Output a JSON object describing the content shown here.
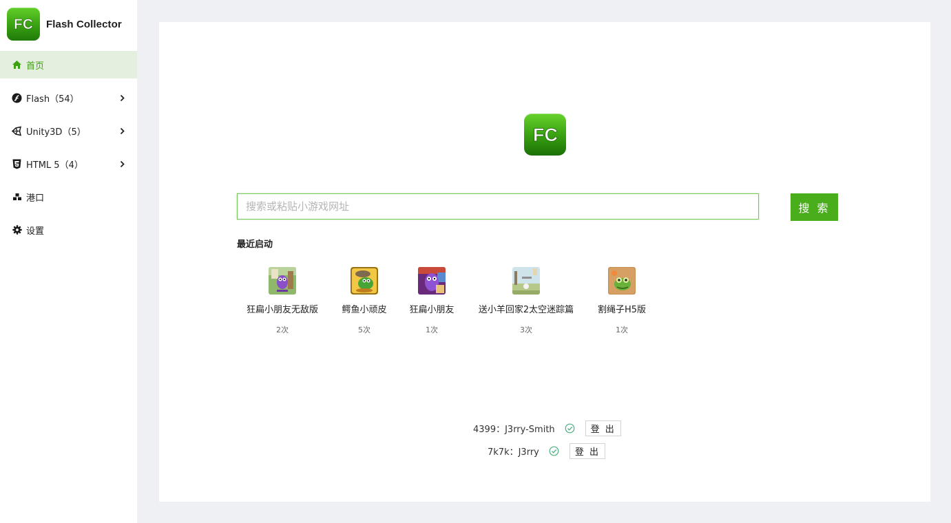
{
  "app": {
    "name": "Flash Collector",
    "logo_text": "FC",
    "accent_color": "#4aae1c"
  },
  "sidebar": {
    "items": [
      {
        "label": "首页",
        "icon": "home-icon",
        "active": true
      },
      {
        "label": "Flash（54）",
        "icon": "flash-icon",
        "has_children": true
      },
      {
        "label": "Unity3D（5）",
        "icon": "unity-icon",
        "has_children": true
      },
      {
        "label": "HTML 5（4）",
        "icon": "html5-icon",
        "has_children": true
      },
      {
        "label": "港口",
        "icon": "port-icon"
      },
      {
        "label": "设置",
        "icon": "gear-icon"
      }
    ]
  },
  "search": {
    "placeholder": "搜索或粘贴小游戏网址",
    "value": "",
    "button_label": "搜 索"
  },
  "recent": {
    "title": "最近启动",
    "games": [
      {
        "name": "狂扁小朋友无敌版",
        "count": "2次"
      },
      {
        "name": "鳄鱼小顽皮",
        "count": "5次"
      },
      {
        "name": "狂扁小朋友",
        "count": "1次"
      },
      {
        "name": "送小羊回家2太空迷踪篇",
        "count": "3次"
      },
      {
        "name": "割绳子H5版",
        "count": "1次"
      }
    ]
  },
  "accounts": [
    {
      "label": "4399：J3rry-Smith",
      "status": "logged-in",
      "logout_label": "登 出"
    },
    {
      "label": "7k7k：J3rry",
      "status": "logged-in",
      "logout_label": "登 出"
    }
  ]
}
